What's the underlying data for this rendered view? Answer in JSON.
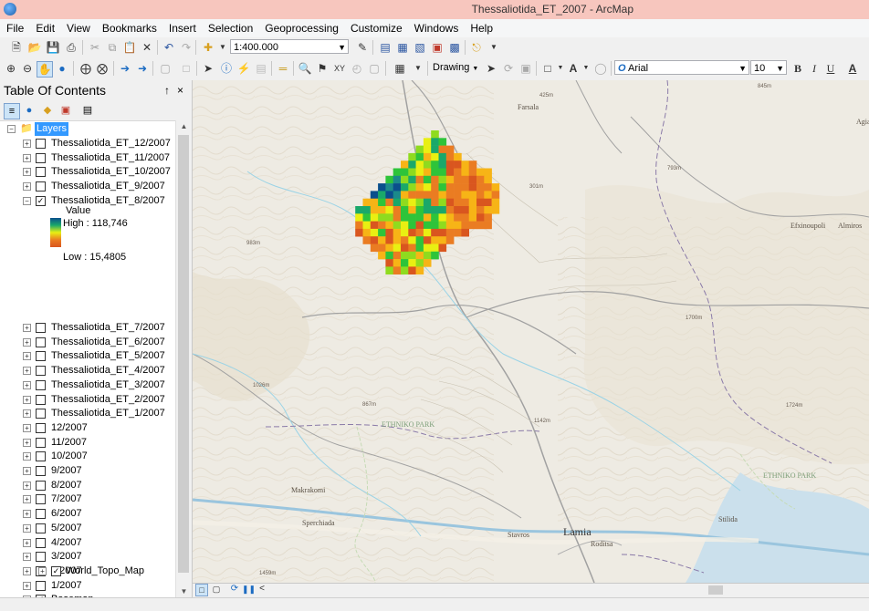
{
  "window": {
    "title": "Thessaliotida_ET_2007 - ArcMap"
  },
  "menu": [
    "File",
    "Edit",
    "View",
    "Bookmarks",
    "Insert",
    "Selection",
    "Geoprocessing",
    "Customize",
    "Windows",
    "Help"
  ],
  "toolbar": {
    "scale": "1:400.000",
    "drawing_label": "Drawing",
    "font_name": "Arial",
    "font_size": "10",
    "bold": "B",
    "italic": "I",
    "underline": "U",
    "font_color": "A"
  },
  "toc": {
    "title": "Table Of Contents",
    "pin": "↑",
    "close": "×",
    "root_label": "Layers",
    "layers_top": [
      {
        "label": "Thessaliotida_ET_12/2007",
        "checked": false
      },
      {
        "label": "Thessaliotida_ET_11/2007",
        "checked": false
      },
      {
        "label": "Thessaliotida_ET_10/2007",
        "checked": false
      },
      {
        "label": "Thessaliotida_ET_9/2007",
        "checked": false
      },
      {
        "label": "Thessaliotida_ET_8/2007",
        "checked": true
      }
    ],
    "legend": {
      "title": "Value",
      "high": "High : 118,746",
      "low": "Low : 15,4805"
    },
    "layers_bottom": [
      {
        "label": "Thessaliotida_ET_7/2007",
        "checked": false
      },
      {
        "label": "Thessaliotida_ET_6/2007",
        "checked": false
      },
      {
        "label": "Thessaliotida_ET_5/2007",
        "checked": false
      },
      {
        "label": "Thessaliotida_ET_4/2007",
        "checked": false
      },
      {
        "label": "Thessaliotida_ET_3/2007",
        "checked": false
      },
      {
        "label": "Thessaliotida_ET_2/2007",
        "checked": false
      },
      {
        "label": "Thessaliotida_ET_1/2007",
        "checked": false
      },
      {
        "label": "12/2007",
        "checked": false
      },
      {
        "label": "11/2007",
        "checked": false
      },
      {
        "label": "10/2007",
        "checked": false
      },
      {
        "label": "9/2007",
        "checked": false
      },
      {
        "label": "8/2007",
        "checked": false
      },
      {
        "label": "7/2007",
        "checked": false
      },
      {
        "label": "6/2007",
        "checked": false
      },
      {
        "label": "5/2007",
        "checked": false
      },
      {
        "label": "4/2007",
        "checked": false
      },
      {
        "label": "3/2007",
        "checked": false
      },
      {
        "label": "2/2007",
        "checked": false
      },
      {
        "label": "1/2007",
        "checked": false
      },
      {
        "label": "Basemap",
        "checked": true
      }
    ],
    "basemap_child": {
      "label": "World_Topo_Map",
      "checked": true
    }
  },
  "map": {
    "places": [
      "Farsala",
      "Agia",
      "Efxinoupoli",
      "Almiros",
      "Makrakomi",
      "Sperchiada",
      "Stavros",
      "Lamia",
      "Rodítsa",
      "Stilida",
      "ETHNIKO PARK"
    ],
    "elevations": [
      "425m",
      "845m",
      "793m",
      "983m",
      "301m",
      "1700m",
      "1026m",
      "867m",
      "1142m",
      "1724m",
      "1459m"
    ],
    "raster_colors": [
      "#0a4f8c",
      "#1b8a8a",
      "#1aa86a",
      "#2ec43a",
      "#8fdb1f",
      "#e9ef12",
      "#f7b416",
      "#ea7c22",
      "#d9561f"
    ]
  }
}
